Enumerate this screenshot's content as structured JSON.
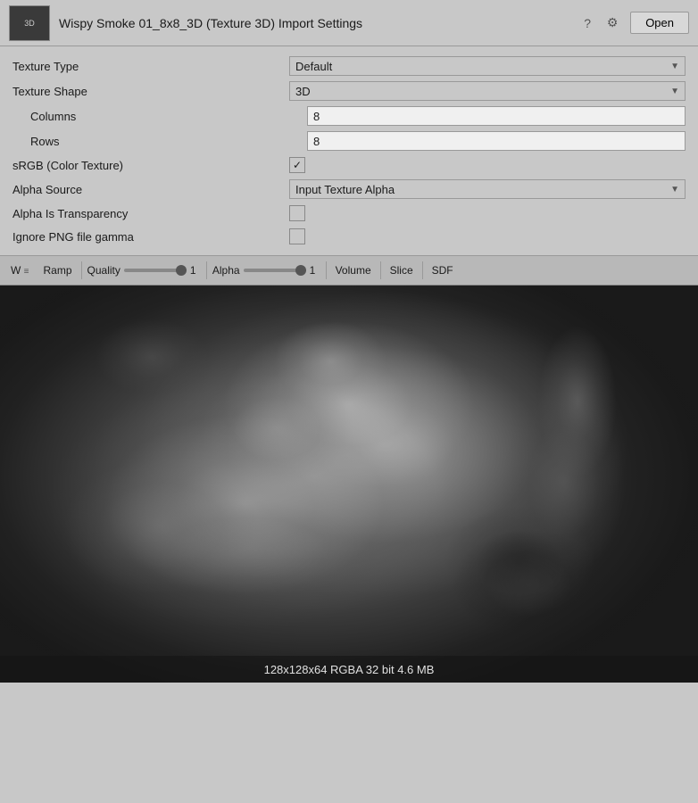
{
  "titleBar": {
    "title": "Wispy Smoke 01_8x8_3D (Texture 3D) Import Settings",
    "openLabel": "Open",
    "helpIcon": "?",
    "settingsIcon": "⚙"
  },
  "settings": {
    "textureTypeLabel": "Texture Type",
    "textureTypeValue": "Default",
    "textureShapeLabel": "Texture Shape",
    "textureShapeValue": "3D",
    "columnsLabel": "Columns",
    "columnsValue": "8",
    "rowsLabel": "Rows",
    "rowsValue": "8",
    "srgbLabel": "sRGB (Color Texture)",
    "alphaSourceLabel": "Alpha Source",
    "alphaSourceValue": "Input Texture Alpha",
    "alphaIsTransparencyLabel": "Alpha Is Transparency",
    "ignorePNGLabel": "Ignore PNG file gamma"
  },
  "toolbar": {
    "wLabel": "W",
    "rampLabel": "Ramp",
    "qualityLabel": "Quality",
    "qualityValue": "1",
    "alphaLabel": "Alpha",
    "alphaValue": "1",
    "volumeLabel": "Volume",
    "sliceLabel": "Slice",
    "sdfLabel": "SDF"
  },
  "preview": {
    "infoText": "128x128x64 RGBA 32 bit 4.6 MB"
  }
}
